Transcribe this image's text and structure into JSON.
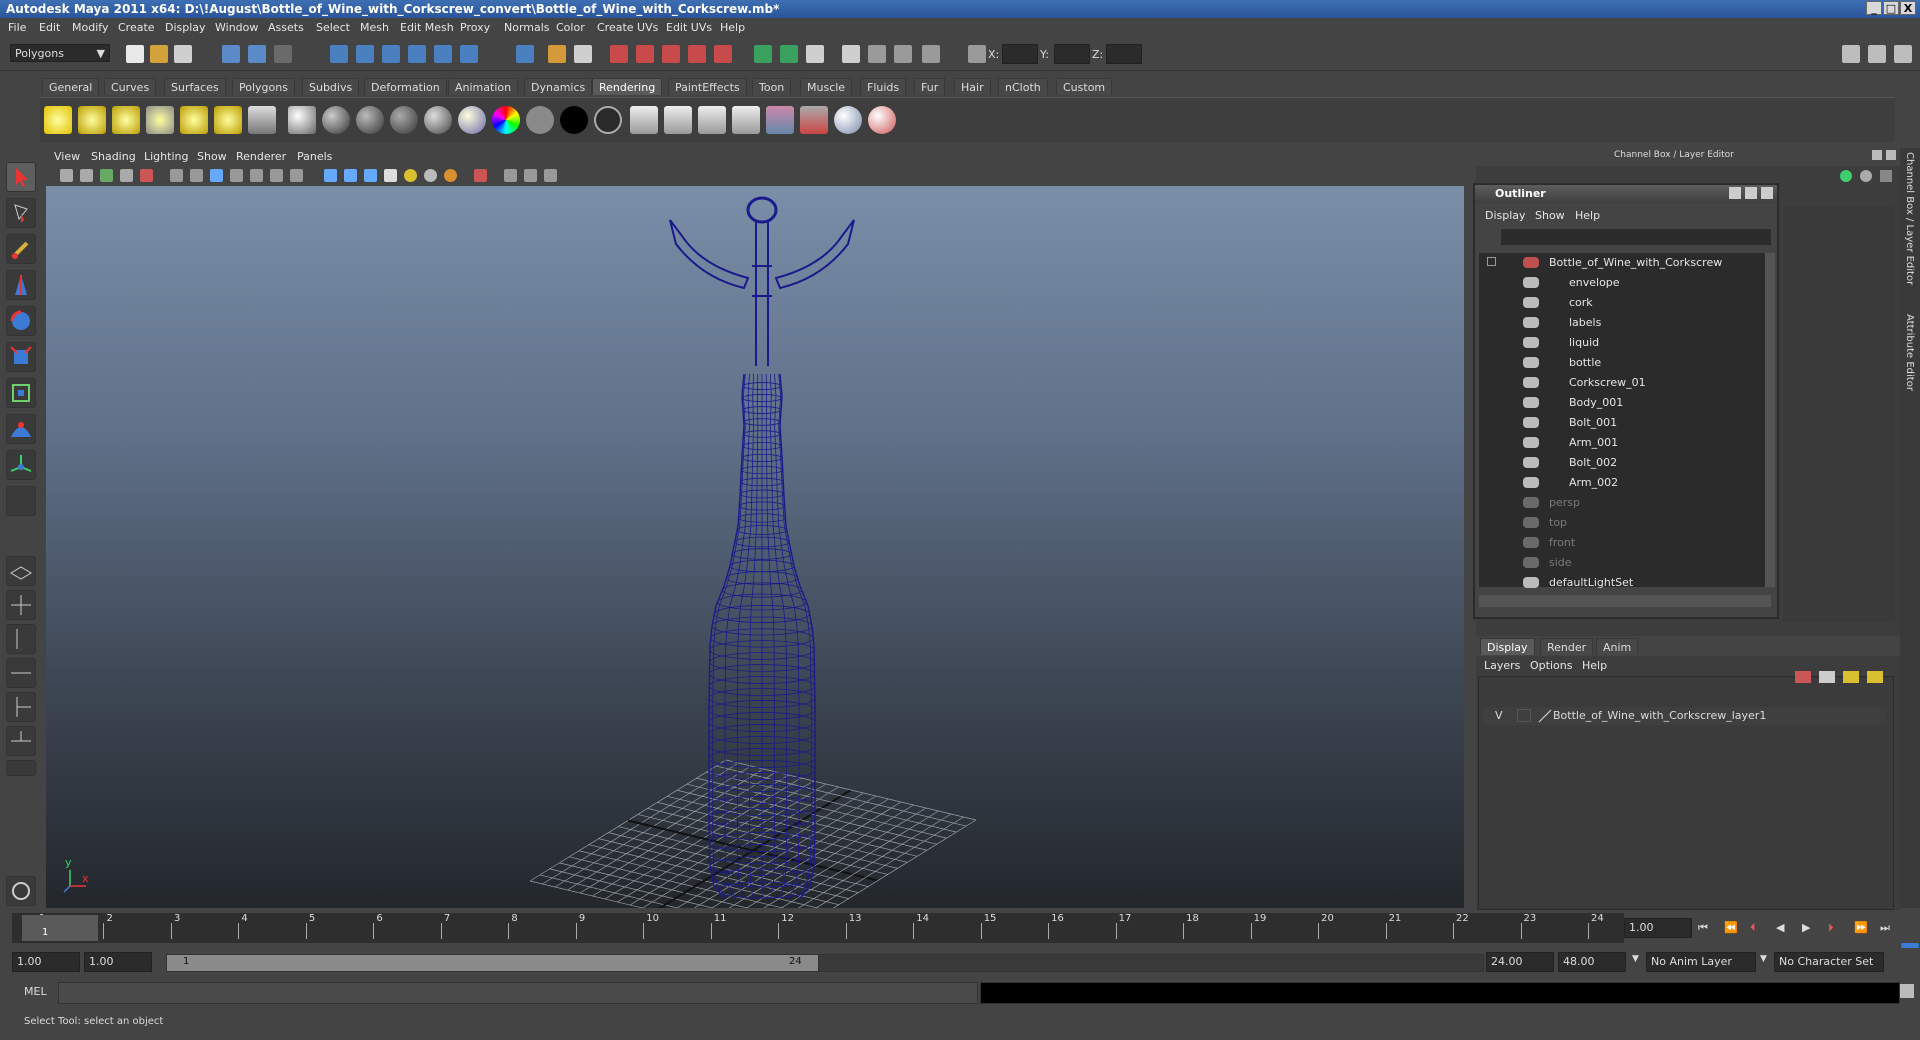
{
  "window": {
    "title": "Autodesk Maya 2011 x64: D:\\!August\\Bottle_of_Wine_with_Corkscrew_convert\\Bottle_of_Wine_with_Corkscrew.mb*",
    "minimize": "_",
    "maximize": "□",
    "close": "X"
  },
  "menu": [
    "File",
    "Edit",
    "Modify",
    "Create",
    "Display",
    "Window",
    "Assets",
    "Select",
    "Mesh",
    "Edit Mesh",
    "Proxy",
    "Normals",
    "Color",
    "Create UVs",
    "Edit UVs",
    "Help"
  ],
  "status": {
    "mode": "Polygons",
    "x_label": "X:",
    "y_label": "Y:",
    "z_label": "Z:"
  },
  "shelf": {
    "tabs": [
      "General",
      "Curves",
      "Surfaces",
      "Polygons",
      "Subdivs",
      "Deformation",
      "Animation",
      "Dynamics",
      "Rendering",
      "PaintEffects",
      "Toon",
      "Muscle",
      "Fluids",
      "Fur",
      "Hair",
      "nCloth",
      "Custom"
    ],
    "active_tab": "Rendering"
  },
  "viewport": {
    "menu": [
      "View",
      "Shading",
      "Lighting",
      "Show",
      "Renderer",
      "Panels"
    ],
    "axis_y": "y",
    "axis_x": "x",
    "wire_color": "#1a1a8c"
  },
  "channel_box": {
    "title": "Channel Box / Layer Editor",
    "side_tab1": "Channel Box / Layer Editor",
    "side_tab2": "Attribute Editor"
  },
  "outliner": {
    "title": "Outliner",
    "menu": [
      "Display",
      "Show",
      "Help"
    ],
    "items": [
      {
        "label": "Bottle_of_Wine_with_Corkscrew",
        "level": 0,
        "dim": false
      },
      {
        "label": "envelope",
        "level": 1,
        "dim": false
      },
      {
        "label": "cork",
        "level": 1,
        "dim": false
      },
      {
        "label": "labels",
        "level": 1,
        "dim": false
      },
      {
        "label": "liquid",
        "level": 1,
        "dim": false
      },
      {
        "label": "bottle",
        "level": 1,
        "dim": false
      },
      {
        "label": "Corkscrew_01",
        "level": 1,
        "dim": false
      },
      {
        "label": "Body_001",
        "level": 1,
        "dim": false
      },
      {
        "label": "Bolt_001",
        "level": 1,
        "dim": false
      },
      {
        "label": "Arm_001",
        "level": 1,
        "dim": false
      },
      {
        "label": "Bolt_002",
        "level": 1,
        "dim": false
      },
      {
        "label": "Arm_002",
        "level": 1,
        "dim": false
      },
      {
        "label": "persp",
        "level": 0,
        "dim": true
      },
      {
        "label": "top",
        "level": 0,
        "dim": true
      },
      {
        "label": "front",
        "level": 0,
        "dim": true
      },
      {
        "label": "side",
        "level": 0,
        "dim": true
      },
      {
        "label": "defaultLightSet",
        "level": 0,
        "dim": false
      }
    ]
  },
  "layer_editor": {
    "tabs": [
      "Display",
      "Render",
      "Anim"
    ],
    "menu": [
      "Layers",
      "Options",
      "Help"
    ],
    "visible_flag": "V",
    "layer_name": "Bottle_of_Wine_with_Corkscrew_layer1"
  },
  "timeline": {
    "ticks": [
      "1",
      "2",
      "3",
      "4",
      "5",
      "6",
      "7",
      "8",
      "9",
      "10",
      "11",
      "12",
      "13",
      "14",
      "15",
      "16",
      "17",
      "18",
      "19",
      "20",
      "21",
      "22",
      "23",
      "24"
    ],
    "current_frame_label": "1",
    "current_time": "1.00"
  },
  "range": {
    "start_time": "1.00",
    "playback_start": "1.00",
    "slider_start": "1",
    "slider_end": "24",
    "playback_end": "24.00",
    "end_time": "48.00",
    "anim_layer": "No Anim Layer",
    "character_set": "No Character Set"
  },
  "command": {
    "label": "MEL"
  },
  "help": {
    "text": "Select Tool: select an object"
  }
}
